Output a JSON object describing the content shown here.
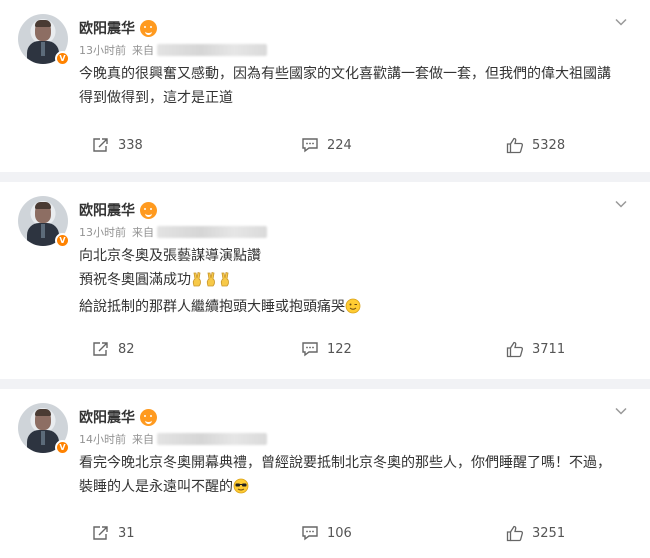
{
  "accent": "#ff8200",
  "posts": [
    {
      "author": "欧阳震华",
      "time": "13小时前",
      "source_prefix": "来自",
      "lines": [
        "今晚真的很興奮又感動，因為有些國家的文化喜歡講一套做一套，但我們的偉大祖國講",
        "得到做得到，這才是正道"
      ],
      "shares": "338",
      "comments": "224",
      "likes": "5328"
    },
    {
      "author": "欧阳震华",
      "time": "13小时前",
      "source_prefix": "来自",
      "lines": [
        "向北京冬奧及張藝謀導演點讚",
        "預祝冬奧圓滿成功",
        "給說抵制的那群人繼續抱頭大睡或抱頭痛哭"
      ],
      "shares": "82",
      "comments": "122",
      "likes": "3711"
    },
    {
      "author": "欧阳震华",
      "time": "14小时前",
      "source_prefix": "来自",
      "lines": [
        "看完今晚北京冬奧開幕典禮，曾經說要抵制北京冬奧的那些人，你們睡醒了嗎！不過，",
        "裝睡的人是永遠叫不醒的"
      ],
      "shares": "31",
      "comments": "106",
      "likes": "3251"
    }
  ]
}
